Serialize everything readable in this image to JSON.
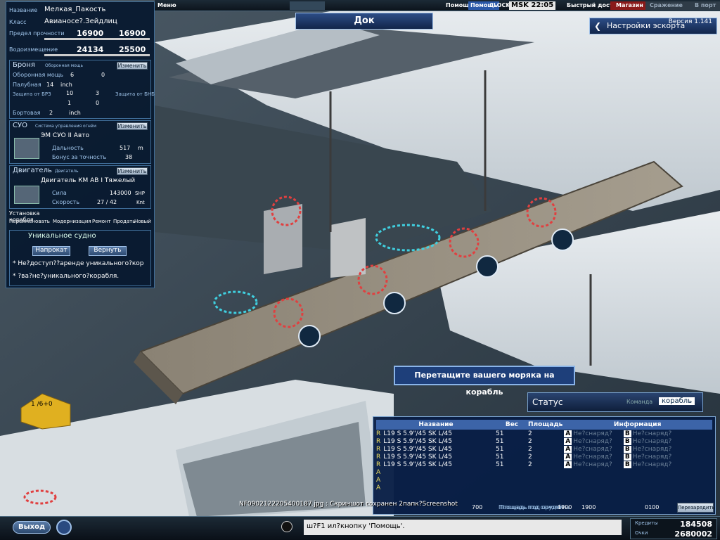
{
  "topbar": {
    "menu": "Меню",
    "help": "Помощь",
    "help2": "Помощь",
    "clock": "CLOCK",
    "time": "MSK 22:05",
    "quick": "Быстрый доступ",
    "shop": "Магазин",
    "battle": "Сражение",
    "port": "В порт"
  },
  "dock_title": "Док",
  "escort": {
    "label": "Настройки эскорта",
    "version": "Версия 1.141"
  },
  "ship": {
    "name_label": "Название",
    "name": "Мелкая_Пакость",
    "class_label": "Класс",
    "class": "Авианосе?.Зейдлиц",
    "durability_label": "Предел прочности",
    "durability_cur": "16900",
    "durability_max": "16900",
    "disp_label": "Водоизмещение",
    "disp_cur": "24134",
    "disp_max": "25500"
  },
  "armor": {
    "title": "Броня",
    "sub": "Оборонная мощь",
    "change": "Изменить",
    "def_label": "Оборонная мощь",
    "def_a": "6",
    "def_b": "0",
    "deck_label": "Палубная",
    "deck_val": "14",
    "deck_unit": "inch",
    "brz_label": "Защита от БРЗ",
    "brz_a": "10",
    "brz_b": "3",
    "brz_c": "1",
    "brz_d": "0",
    "bnb_label": "Защита от БНБ",
    "side_label": "Бортовая",
    "side_val": "2",
    "side_unit": "inch"
  },
  "suo": {
    "title": "СУО",
    "sub": "Система управления огнём",
    "change": "Изменить",
    "name": "ЭМ СУО II Авто",
    "range_label": "Дальность",
    "range_val": "517",
    "range_unit": "m",
    "acc_label": "Бонус за точность",
    "acc_val": "38"
  },
  "engine": {
    "title": "Двигатель",
    "sub": "Двигатель",
    "change": "Изменить",
    "name": "Двигатель КМ АВ I Тяжелый",
    "power_label": "Сила",
    "power_val": "143000",
    "power_unit": "SHP",
    "speed_label": "Скорость",
    "speed_val": "27 / 42",
    "speed_unit": "Knt"
  },
  "install": {
    "label": "Установка корабля"
  },
  "tabs": [
    "Переименовать",
    "Модернизация",
    "Ремонт",
    "Продать",
    "Новый"
  ],
  "unique": {
    "title": "Уникальное судно",
    "rent": "Напрокат",
    "return": "Вернуть",
    "line1": "* Не?доступ??аренде уникального?кор",
    "line2": "* ?ва?не?уникального?корабля."
  },
  "hint": "Перетащите вашего моряка на корабль",
  "status": {
    "title": "Статус",
    "tab_crew": "Команда",
    "tab_ship": "корабль"
  },
  "table": {
    "headers": [
      "Название",
      "Вес",
      "Площадь",
      "Информация"
    ],
    "rows": [
      {
        "prefix": "R",
        "name": "L19 S 5.9\"/45 SK L/45",
        "weight": "51",
        "area": "2",
        "info_a": "Не?снаряд?",
        "info_b": "Не?снаряд?"
      },
      {
        "prefix": "R",
        "name": "L19 S 5.9\"/45 SK L/45",
        "weight": "51",
        "area": "2",
        "info_a": "Не?снаряд?",
        "info_b": "Не?снаряд?"
      },
      {
        "prefix": "R",
        "name": "L19 S 5.9\"/45 SK L/45",
        "weight": "51",
        "area": "2",
        "info_a": "Не?снаряд?",
        "info_b": "Не?снаряд?"
      },
      {
        "prefix": "R",
        "name": "L19 S 5.9\"/45 SK L/45",
        "weight": "51",
        "area": "2",
        "info_a": "Не?снаряд?",
        "info_b": "Не?снаряд?"
      },
      {
        "prefix": "R",
        "name": "L19 S 5.9\"/45 SK L/45",
        "weight": "51",
        "area": "2",
        "info_a": "Не?снаряд?",
        "info_b": "Не?снаряд?"
      },
      {
        "prefix": "A",
        "name": "",
        "weight": "",
        "area": "",
        "info_a": "",
        "info_b": ""
      },
      {
        "prefix": "A",
        "name": "",
        "weight": "",
        "area": "",
        "info_a": "",
        "info_b": ""
      },
      {
        "prefix": "A",
        "name": "",
        "weight": "",
        "area": "",
        "info_a": "",
        "info_b": ""
      }
    ],
    "footer_area_label": "Площадь под самолёты",
    "footer_area_a": "1900",
    "footer_area_b": "1900",
    "footer_other": "0100",
    "reload": "Перезарядить",
    "footer_weight_label": "Площадь под орудия",
    "footer_weight": "700"
  },
  "screenshot_msg": "NF0902122205400187.jpg : Скриншот сохранен 2папк?Screenshot",
  "chat": "ш?F1 ил?кнопку 'Помощь'.",
  "exit": "Выход",
  "map_counter": "1 /6+0",
  "credits": {
    "credits_label": "Кредиты",
    "credits_val": "184508",
    "points_label": "Очки",
    "points_val": "2680002"
  },
  "colors": {
    "panel_bg": "#06182e",
    "accent": "#3f6d98",
    "yellow": "#f0e060",
    "hint_bg": "#1e3f7a"
  }
}
